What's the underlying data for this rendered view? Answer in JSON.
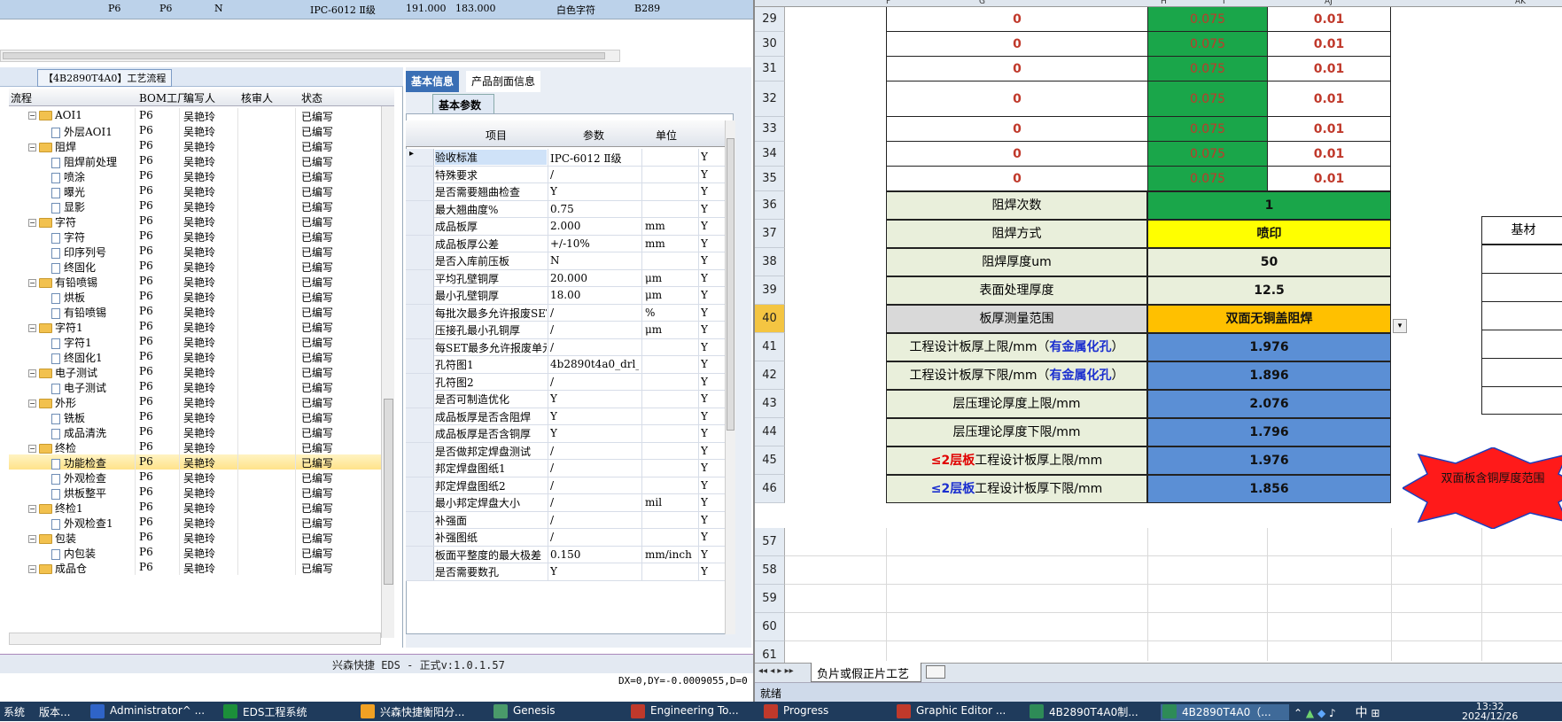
{
  "topband": [
    "P6",
    "P6",
    "N",
    "IPC-6012 Ⅱ级",
    "191.000",
    "183.000",
    "白色字符",
    "B289"
  ],
  "tree": {
    "title": "【4B2890T4A0】工艺流程",
    "headers": [
      "流程",
      "BOM工厂",
      "编写人",
      "核审人",
      "状态"
    ],
    "rows": [
      {
        "label": "AOI1",
        "lvl": 1,
        "type": "folder",
        "bom": "P6",
        "author": "吴艳玲",
        "status": "已编写"
      },
      {
        "label": "外层AOI1",
        "lvl": 2,
        "type": "doc",
        "bom": "P6",
        "author": "吴艳玲",
        "status": "已编写"
      },
      {
        "label": "阻焊",
        "lvl": 1,
        "type": "folder",
        "bom": "P6",
        "author": "吴艳玲",
        "status": "已编写"
      },
      {
        "label": "阻焊前处理",
        "lvl": 2,
        "type": "doc",
        "bom": "P6",
        "author": "吴艳玲",
        "status": "已编写"
      },
      {
        "label": "喷涂",
        "lvl": 2,
        "type": "doc",
        "bom": "P6",
        "author": "吴艳玲",
        "status": "已编写"
      },
      {
        "label": "曝光",
        "lvl": 2,
        "type": "doc",
        "bom": "P6",
        "author": "吴艳玲",
        "status": "已编写"
      },
      {
        "label": "显影",
        "lvl": 2,
        "type": "doc",
        "bom": "P6",
        "author": "吴艳玲",
        "status": "已编写"
      },
      {
        "label": "字符",
        "lvl": 1,
        "type": "folder",
        "bom": "P6",
        "author": "吴艳玲",
        "status": "已编写"
      },
      {
        "label": "字符",
        "lvl": 2,
        "type": "doc",
        "bom": "P6",
        "author": "吴艳玲",
        "status": "已编写"
      },
      {
        "label": "印序列号",
        "lvl": 2,
        "type": "doc",
        "bom": "P6",
        "author": "吴艳玲",
        "status": "已编写"
      },
      {
        "label": "终固化",
        "lvl": 2,
        "type": "doc",
        "bom": "P6",
        "author": "吴艳玲",
        "status": "已编写"
      },
      {
        "label": "有铅喷锡",
        "lvl": 1,
        "type": "folder",
        "bom": "P6",
        "author": "吴艳玲",
        "status": "已编写"
      },
      {
        "label": "烘板",
        "lvl": 2,
        "type": "doc",
        "bom": "P6",
        "author": "吴艳玲",
        "status": "已编写"
      },
      {
        "label": "有铅喷锡",
        "lvl": 2,
        "type": "doc",
        "bom": "P6",
        "author": "吴艳玲",
        "status": "已编写"
      },
      {
        "label": "字符1",
        "lvl": 1,
        "type": "folder",
        "bom": "P6",
        "author": "吴艳玲",
        "status": "已编写"
      },
      {
        "label": "字符1",
        "lvl": 2,
        "type": "doc",
        "bom": "P6",
        "author": "吴艳玲",
        "status": "已编写"
      },
      {
        "label": "终固化1",
        "lvl": 2,
        "type": "doc",
        "bom": "P6",
        "author": "吴艳玲",
        "status": "已编写"
      },
      {
        "label": "电子测试",
        "lvl": 1,
        "type": "folder",
        "bom": "P6",
        "author": "吴艳玲",
        "status": "已编写"
      },
      {
        "label": "电子测试",
        "lvl": 2,
        "type": "doc",
        "bom": "P6",
        "author": "吴艳玲",
        "status": "已编写"
      },
      {
        "label": "外形",
        "lvl": 1,
        "type": "folder",
        "bom": "P6",
        "author": "吴艳玲",
        "status": "已编写"
      },
      {
        "label": "铣板",
        "lvl": 2,
        "type": "doc",
        "bom": "P6",
        "author": "吴艳玲",
        "status": "已编写"
      },
      {
        "label": "成品清洗",
        "lvl": 2,
        "type": "doc",
        "bom": "P6",
        "author": "吴艳玲",
        "status": "已编写"
      },
      {
        "label": "终检",
        "lvl": 1,
        "type": "folder",
        "bom": "P6",
        "author": "吴艳玲",
        "status": "已编写"
      },
      {
        "label": "功能检查",
        "lvl": 2,
        "type": "doc",
        "bom": "P6",
        "author": "吴艳玲",
        "status": "已编写",
        "selected": true
      },
      {
        "label": "外观检查",
        "lvl": 2,
        "type": "doc",
        "bom": "P6",
        "author": "吴艳玲",
        "status": "已编写"
      },
      {
        "label": "烘板整平",
        "lvl": 2,
        "type": "doc",
        "bom": "P6",
        "author": "吴艳玲",
        "status": "已编写"
      },
      {
        "label": "终检1",
        "lvl": 1,
        "type": "folder",
        "bom": "P6",
        "author": "吴艳玲",
        "status": "已编写"
      },
      {
        "label": "外观检查1",
        "lvl": 2,
        "type": "doc",
        "bom": "P6",
        "author": "吴艳玲",
        "status": "已编写"
      },
      {
        "label": "包装",
        "lvl": 1,
        "type": "folder",
        "bom": "P6",
        "author": "吴艳玲",
        "status": "已编写"
      },
      {
        "label": "内包装",
        "lvl": 2,
        "type": "doc",
        "bom": "P6",
        "author": "吴艳玲",
        "status": "已编写"
      },
      {
        "label": "成品仓",
        "lvl": 1,
        "type": "folder",
        "bom": "P6",
        "author": "吴艳玲",
        "status": "已编写"
      }
    ]
  },
  "tabs": [
    "基本信息",
    "产品剖面信息"
  ],
  "subtab": "基本参数",
  "grid": {
    "headers": [
      "项目",
      "参数",
      "单位"
    ],
    "rows": [
      [
        "验收标准",
        "IPC-6012 Ⅱ级",
        "",
        "Y"
      ],
      [
        "特殊要求",
        "/",
        "",
        "Y"
      ],
      [
        "是否需要翘曲检查",
        "Y",
        "",
        "Y"
      ],
      [
        "最大翘曲度%",
        "0.75",
        "",
        "Y"
      ],
      [
        "成品板厚",
        "2.000",
        "mm",
        "Y"
      ],
      [
        "成品板厚公差",
        "+/-10%",
        "mm",
        "Y"
      ],
      [
        "是否入库前压板",
        "N",
        "",
        "Y"
      ],
      [
        "平均孔壁铜厚",
        "20.000",
        "μm",
        "Y"
      ],
      [
        "最小孔壁铜厚",
        "18.00",
        "μm",
        "Y"
      ],
      [
        "每批次最多允许报废SET",
        "/",
        "%",
        "Y"
      ],
      [
        "压接孔最小孔铜厚",
        "/",
        "μm",
        "Y"
      ],
      [
        "每SET最多允许报废单元",
        "/",
        "",
        "Y"
      ],
      [
        "孔符图1",
        "4b2890t4a0_drl_m...",
        "",
        "Y"
      ],
      [
        "孔符图2",
        "/",
        "",
        "Y"
      ],
      [
        "是否可制造优化",
        "Y",
        "",
        "Y"
      ],
      [
        "成品板厚是否含阻焊",
        "Y",
        "",
        "Y"
      ],
      [
        "成品板厚是否含铜厚",
        "Y",
        "",
        "Y"
      ],
      [
        "是否做邦定焊盘测试",
        "/",
        "",
        "Y"
      ],
      [
        "邦定焊盘图纸1",
        "/",
        "",
        "Y"
      ],
      [
        "邦定焊盘图纸2",
        "/",
        "",
        "Y"
      ],
      [
        "最小邦定焊盘大小",
        "/",
        "mil",
        "Y"
      ],
      [
        "补强面",
        "/",
        "",
        "Y"
      ],
      [
        "补强图纸",
        "/",
        "",
        "Y"
      ],
      [
        "板面平整度的最大极差",
        "0.150",
        "mm/inch",
        "Y"
      ],
      [
        "是否需要数孔",
        "Y",
        "",
        "Y"
      ]
    ]
  },
  "status": "兴森快捷 EDS - 正式v:1.0.1.57",
  "coords": "DX=0,DY=-0.0009055,D=0",
  "excel": {
    "cols": [
      "F",
      "G",
      "H",
      "I",
      "AJ",
      "AK"
    ],
    "green_rows": [
      {
        "num": "29",
        "g": "0",
        "h": "0.075",
        "i": "0.01"
      },
      {
        "num": "30",
        "g": "0",
        "h": "0.075",
        "i": "0.01"
      },
      {
        "num": "31",
        "g": "0",
        "h": "0.075",
        "i": "0.01"
      },
      {
        "num": "32",
        "g": "0",
        "h": "0.075",
        "i": "0.01"
      },
      {
        "num": "33",
        "g": "0",
        "h": "0.075",
        "i": "0.01"
      },
      {
        "num": "34",
        "g": "0",
        "h": "0.075",
        "i": "0.01"
      },
      {
        "num": "35",
        "g": "0",
        "h": "0.075",
        "i": "0.01"
      }
    ],
    "param_rows": [
      {
        "num": "36",
        "label": "阻焊次数",
        "value": "1",
        "bg": "#1aa64a"
      },
      {
        "num": "37",
        "label": "阻焊方式",
        "value": "喷印",
        "bg": "#ffff00"
      },
      {
        "num": "38",
        "label": "阻焊厚度um",
        "value": "50",
        "bg": "#e9efdb"
      },
      {
        "num": "39",
        "label": "表面处理厚度",
        "value": "12.5",
        "bg": "#e9efdb"
      },
      {
        "num": "40",
        "label": "板厚测量范围",
        "value": "双面无铜盖阻焊",
        "bg": "#ffc000"
      },
      {
        "num": "41",
        "label": "工程设计板厚上限/mm（",
        "label_hl": "有金属化孔",
        "label_tail": "）",
        "value": "1.976",
        "bg": "#5b8fd5"
      },
      {
        "num": "42",
        "label": "工程设计板厚下限/mm（",
        "label_hl": "有金属化孔",
        "label_tail": "）",
        "value": "1.896",
        "bg": "#5b8fd5"
      },
      {
        "num": "43",
        "label": "层压理论厚度上限/mm",
        "value": "2.076",
        "bg": "#5b8fd5"
      },
      {
        "num": "44",
        "label": "层压理论厚度下限/mm",
        "value": "1.796",
        "bg": "#5b8fd5"
      },
      {
        "num": "45",
        "label_pre": "≤2层板",
        "label": "工程设计板厚上限/mm",
        "value": "1.976",
        "bg": "#5b8fd5",
        "pre_color": "#e00000"
      },
      {
        "num": "46",
        "label_pre": "≤2层板",
        "label": "工程设计板厚下限/mm",
        "value": "1.856",
        "bg": "#5b8fd5",
        "pre_color": "#1b2fcf"
      }
    ],
    "tail_rows": [
      "57",
      "58",
      "59",
      "60",
      "61"
    ],
    "side_label": "基材",
    "star_text": "双面板含铜厚度范围",
    "sheet_tab": "负片或假正片工艺",
    "ready": "就绪"
  },
  "taskbar": [
    {
      "label": "系统",
      "color": "#ffffff"
    },
    {
      "label": "版本...",
      "color": "#ffffff"
    },
    {
      "label": "Administrator^ ...",
      "color": "#2f64c8"
    },
    {
      "label": "EDS工程系统",
      "color": "#1c8f3a"
    },
    {
      "label": "兴森快捷衡阳分...",
      "color": "#f1a123"
    },
    {
      "label": "Genesis",
      "color": "#4a9a6a"
    },
    {
      "label": "Engineering To...",
      "color": "#c0392b"
    },
    {
      "label": "Progress",
      "color": "#c0392b"
    },
    {
      "label": "Graphic Editor ...",
      "color": "#c0392b"
    },
    {
      "label": "4B2890T4A0制...",
      "color": "#2e8b57"
    },
    {
      "label": "4B2890T4A0（...",
      "color": "#2e8b57"
    }
  ],
  "tray_lang": "中",
  "clock_time": "13:32",
  "clock_date": "2024/12/26"
}
